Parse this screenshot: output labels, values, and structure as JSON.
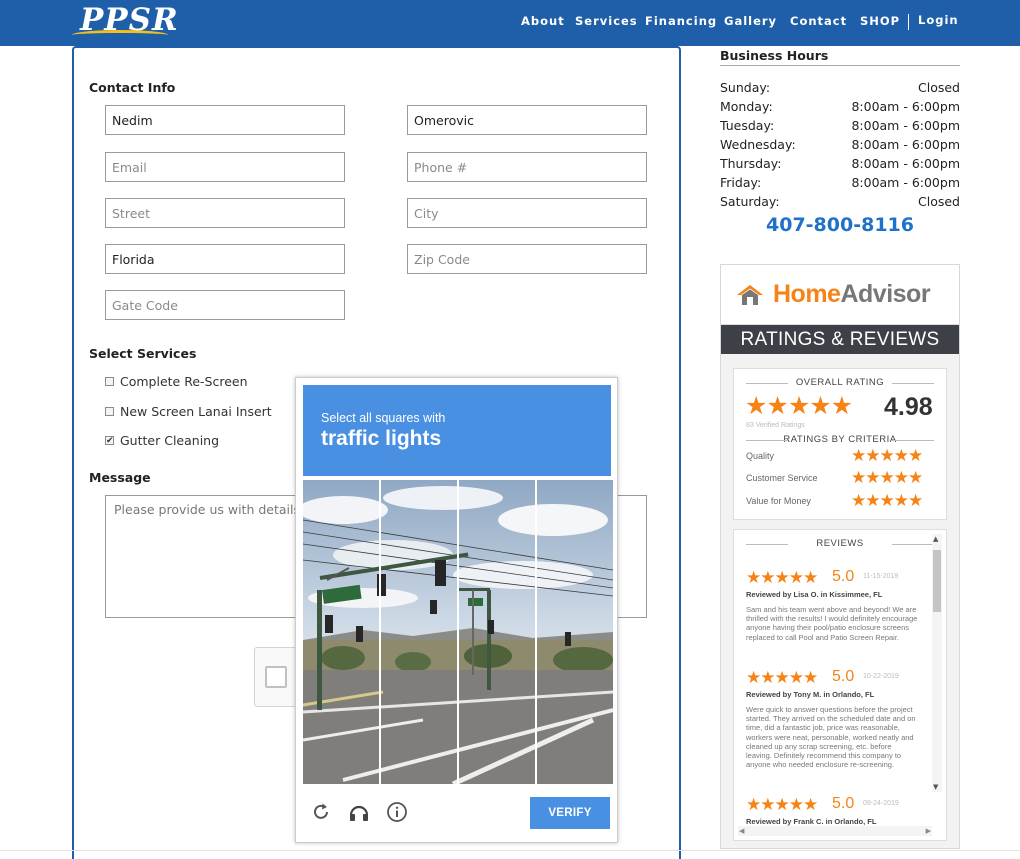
{
  "header": {
    "logo": "PPSR",
    "nav": [
      "About",
      "Services",
      "Financing",
      "Gallery",
      "Contact",
      "SHOP"
    ],
    "login": "Login"
  },
  "contact": {
    "title": "Contact Info",
    "first_name": "Nedim",
    "last_name": "Omerovic",
    "email_placeholder": "Email",
    "phone_placeholder": "Phone #",
    "street_placeholder": "Street",
    "city_placeholder": "City",
    "state": "Florida",
    "zip_placeholder": "Zip Code",
    "gate_placeholder": "Gate Code"
  },
  "services": {
    "title": "Select Services",
    "items": [
      {
        "label": "Complete Re-Screen",
        "checked": false
      },
      {
        "label": "New Screen Lanai Insert",
        "checked": false
      },
      {
        "label": "Gutter Cleaning",
        "checked": true
      }
    ]
  },
  "message": {
    "title": "Message",
    "placeholder": "Please provide us with details ab"
  },
  "hours": {
    "title": "Business Hours",
    "rows": [
      {
        "day": "Sunday:",
        "time": "Closed"
      },
      {
        "day": "Monday:",
        "time": "8:00am - 6:00pm"
      },
      {
        "day": "Tuesday:",
        "time": "8:00am - 6:00pm"
      },
      {
        "day": "Wednesday:",
        "time": "8:00am - 6:00pm"
      },
      {
        "day": "Thursday:",
        "time": "8:00am - 6:00pm"
      },
      {
        "day": "Friday:",
        "time": "8:00am - 6:00pm"
      },
      {
        "day": "Saturday:",
        "time": "Closed"
      }
    ],
    "phone": "407-800-8116"
  },
  "homeadvisor": {
    "logo_home": "Home",
    "logo_advisor": "Advisor",
    "banner": "RATINGS & REVIEWS",
    "overall_title": "OVERALL RATING",
    "overall_value": "4.98",
    "verified": "83 Verified Ratings",
    "criteria_title": "RATINGS BY CRITERIA",
    "criteria": [
      "Quality",
      "Customer Service",
      "Value for Money"
    ],
    "reviews_title": "REVIEWS",
    "reviews": [
      {
        "score": "5.0",
        "date": "11-15-2019",
        "by": "Reviewed by Lisa O. in Kissimmee, FL",
        "text": "Sam and his team went above and beyond! We are thrilled with the results! I would definitely encourage anyone having their pool/patio enclosure screens replaced to call Pool and Patio Screen Repair."
      },
      {
        "score": "5.0",
        "date": "10-22-2019",
        "by": "Reviewed by Tony M. in Orlando, FL",
        "text": "Were quick to answer questions before the project started. They arrived on the scheduled date and on time, did a fantastic job, price was reasonable, workers were neat, personable, worked neatly and cleaned up any scrap screening, etc. before leaving. Definitely recommend this company to anyone who needed enclosure re-screening."
      },
      {
        "score": "5.0",
        "date": "09-24-2019",
        "by": "Reviewed by Frank C. in Orlando, FL",
        "text": ""
      }
    ],
    "star_color": "#f68315"
  },
  "captcha": {
    "instruction": "Select all squares with",
    "target": "traffic lights",
    "verify": "VERIFY",
    "icons": [
      "reload-icon",
      "audio-icon",
      "info-icon"
    ],
    "accent": "#4a90e2"
  }
}
